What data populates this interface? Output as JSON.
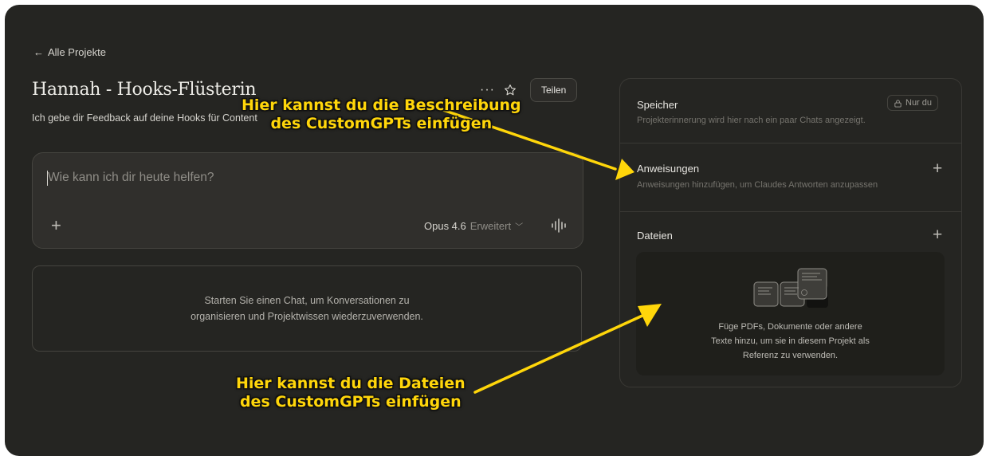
{
  "nav": {
    "back_label": "Alle Projekte"
  },
  "project": {
    "title": "Hannah - Hooks-Flüsterin",
    "description": "Ich gebe dir Feedback auf deine Hooks für Content",
    "share_label": "Teilen"
  },
  "composer": {
    "placeholder": "Wie kann ich dir heute helfen?",
    "model": "Opus 4.6",
    "mode": "Erweitert"
  },
  "empty_state": {
    "line1": "Starten Sie einen Chat, um Konversationen zu",
    "line2": "organisieren und Projektwissen wiederzuverwenden."
  },
  "panel": {
    "memory": {
      "title": "Speicher",
      "subtitle": "Projekterinnerung wird hier nach ein paar Chats angezeigt.",
      "badge": "Nur du"
    },
    "instructions": {
      "title": "Anweisungen",
      "subtitle": "Anweisungen hinzufügen, um Claudes Antworten anzupassen"
    },
    "files": {
      "title": "Dateien",
      "line1": "Füge PDFs, Dokumente oder andere",
      "line2": "Texte hinzu, um sie in diesem Projekt als",
      "line3": "Referenz zu verwenden."
    }
  },
  "annotations": {
    "top_line1": "Hier kannst du die Beschreibung",
    "top_line2": "des CustomGPTs einfügen",
    "bottom_line1": "Hier kannst du die Dateien",
    "bottom_line2": "des CustomGPTs einfügen"
  },
  "colors": {
    "background": "#252522",
    "annotation": "#ffd60a"
  }
}
